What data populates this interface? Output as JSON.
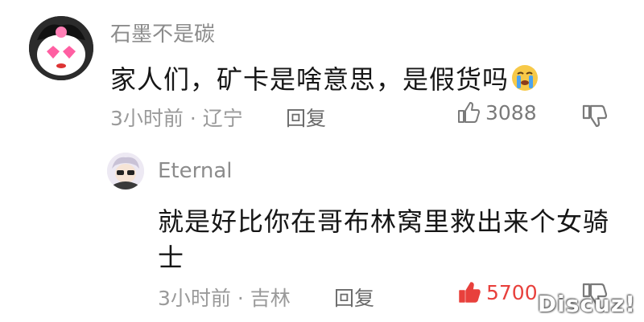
{
  "comments": [
    {
      "username": "石墨不是碳",
      "text": "家人们，矿卡是啥意思，是假货吗",
      "emoji": "crying-face-icon",
      "time_location": "3小时前 · 辽宁",
      "reply_label": "回复",
      "likes": "3088",
      "liked": false
    },
    {
      "username": "Eternal",
      "text_line1": "就是好比你在哥布林窝里救出来个女骑",
      "text_line2": "士",
      "time_location": "3小时前 · 吉林",
      "reply_label": "回复",
      "likes": "5700",
      "liked": true
    }
  ],
  "watermark": "Discuz!",
  "colors": {
    "liked": "#e8403c",
    "meta": "#9a9a9a",
    "text": "#161616"
  }
}
